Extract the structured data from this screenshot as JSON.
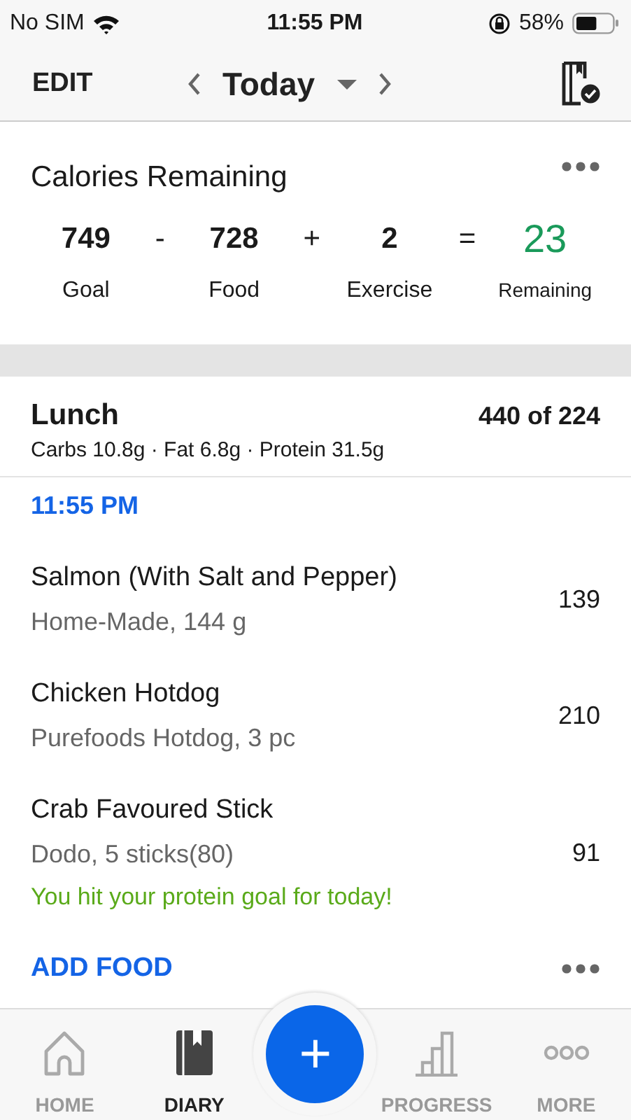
{
  "status_bar": {
    "carrier": "No SIM",
    "time": "11:55 PM",
    "battery": "58%"
  },
  "nav": {
    "edit": "EDIT",
    "date": "Today"
  },
  "summary": {
    "title": "Calories Remaining",
    "items": [
      {
        "kind": "term",
        "value": "749",
        "label": "Goal"
      },
      {
        "kind": "term",
        "operator": "-",
        "value": "728",
        "label": "Food"
      },
      {
        "kind": "term",
        "operator": "+",
        "value": "2",
        "label": "Exercise"
      },
      {
        "kind": "result",
        "operator": "=",
        "value": "23",
        "label": "Remaining"
      }
    ]
  },
  "meal": {
    "name": "Lunch",
    "calories": "440 of 224",
    "macros": "Carbs 10.8g · Fat 6.8g · Protein 31.5g",
    "time": "11:55 PM",
    "foods": [
      {
        "name": "Salmon (With Salt and Pepper)",
        "detail": "Home-Made, 144 g",
        "calories": "139"
      },
      {
        "name": "Chicken Hotdog",
        "detail": "Purefoods Hotdog, 3 pc",
        "calories": "210"
      },
      {
        "name": "Crab Favoured Stick",
        "detail": "Dodo, 5 sticks(80)",
        "calories": "91",
        "note": "You hit your protein goal for today!"
      }
    ],
    "add_food": "ADD FOOD"
  },
  "tab_bar": [
    {
      "kind": "tab",
      "label": "HOME",
      "selected": false
    },
    {
      "kind": "tab",
      "label": "DIARY",
      "selected": true
    },
    {
      "kind": "action",
      "label": "+",
      "selected": false
    },
    {
      "kind": "tab",
      "label": "PROGRESS",
      "selected": false
    },
    {
      "kind": "tab",
      "label": "MORE",
      "selected": false
    }
  ]
}
